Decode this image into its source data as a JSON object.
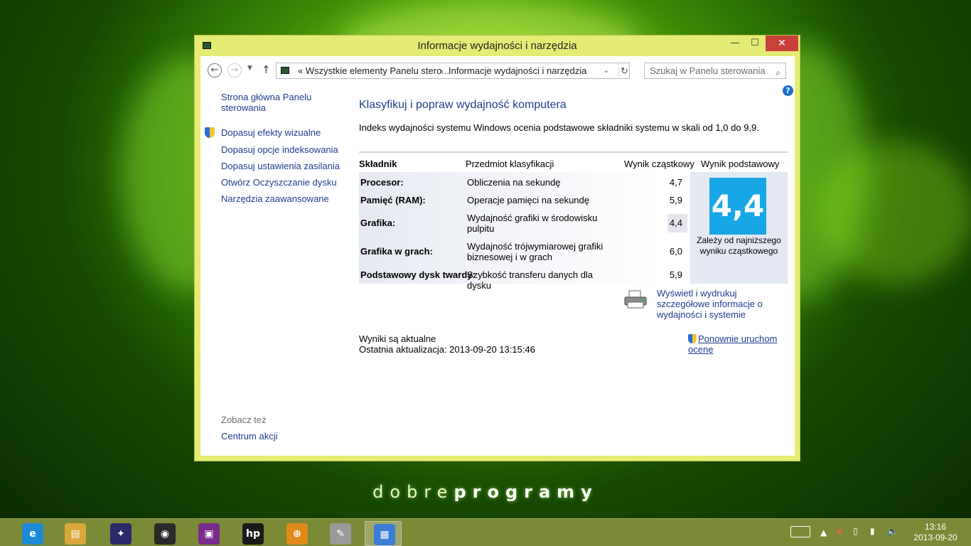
{
  "window": {
    "title": "Informacje wydajności i narzędzia",
    "minimize": "—",
    "maximize": "☐",
    "close": "✕"
  },
  "address": {
    "back": "←",
    "forward": "→",
    "up": "↑",
    "path_part1": "«  Wszystkie elementy Panelu stero...",
    "path_separator": "›",
    "path_part2": "Informacje wydajności i narzędzia",
    "search_placeholder": "Szukaj w Panelu sterowania"
  },
  "sidebar": {
    "home": "Strona główna Panelu sterowania",
    "items": [
      "Dopasuj efekty wizualne",
      "Dopasuj opcje indeksowania",
      "Dopasuj ustawienia zasilania",
      "Otwórz Oczyszczanie dysku",
      "Narzędzia zaawansowane"
    ],
    "see_also": "Zobacz też",
    "action_center": "Centrum akcji"
  },
  "main": {
    "heading": "Klasyfikuj i popraw wydajność komputera",
    "description": "Indeks wydajności systemu Windows ocenia podstawowe składniki systemu w skali od 1,0 do 9,9.",
    "columns": [
      "Składnik",
      "Przedmiot klasyfikacji",
      "Wynik cząstkowy",
      "Wynik podstawowy"
    ],
    "rows": [
      {
        "component": "Procesor:",
        "subject": "Obliczenia na sekundę",
        "score": "4,7"
      },
      {
        "component": "Pamięć (RAM):",
        "subject": "Operacje pamięci na sekundę",
        "score": "5,9"
      },
      {
        "component": "Grafika:",
        "subject": "Wydajność grafiki w środowisku pulpitu",
        "score": "4,4"
      },
      {
        "component": "Grafika w grach:",
        "subject": "Wydajność trójwymiarowej grafiki biznesowej i w grach",
        "score": "6,0"
      },
      {
        "component": "Podstawowy dysk twardy:",
        "subject": "Szybkość transferu danych dla dysku",
        "score": "5,9"
      }
    ],
    "base_score": "4,4",
    "base_note": "Zależy od najniższego wyniku cząstkowego",
    "print_link": "Wyświetl i wydrukuj szczegółowe informacje o wydajności i systemie",
    "status": "Wyniki są aktualne",
    "last_update": "Ostatnia aktualizacja: 2013-09-20 13:15:46",
    "rerun": "Ponownie uruchom ocenę"
  },
  "wallpaper": {
    "brand_light": "dobre",
    "brand_bold": "programy"
  },
  "taskbar": {
    "apps": [
      {
        "name": "internet-explorer",
        "glyph": "e",
        "color": "#1e8ad6"
      },
      {
        "name": "file-explorer",
        "glyph": "▤",
        "color": "#d9a73a"
      },
      {
        "name": "puzzle-app",
        "glyph": "✦",
        "color": "#2a2a6a"
      },
      {
        "name": "media-player",
        "glyph": "◉",
        "color": "#2a2a2a"
      },
      {
        "name": "presentation-app",
        "glyph": "▣",
        "color": "#7a2b8c"
      },
      {
        "name": "hp-app",
        "glyph": "hp",
        "color": "#1a1a1a"
      },
      {
        "name": "globe-app",
        "glyph": "⊕",
        "color": "#e08a1a"
      },
      {
        "name": "paint-app",
        "glyph": "✎",
        "color": "#9a9a9a"
      },
      {
        "name": "control-panel",
        "glyph": "▦",
        "color": "#3a7ed8"
      }
    ],
    "time": "13:16",
    "date": "2013-09-20"
  }
}
